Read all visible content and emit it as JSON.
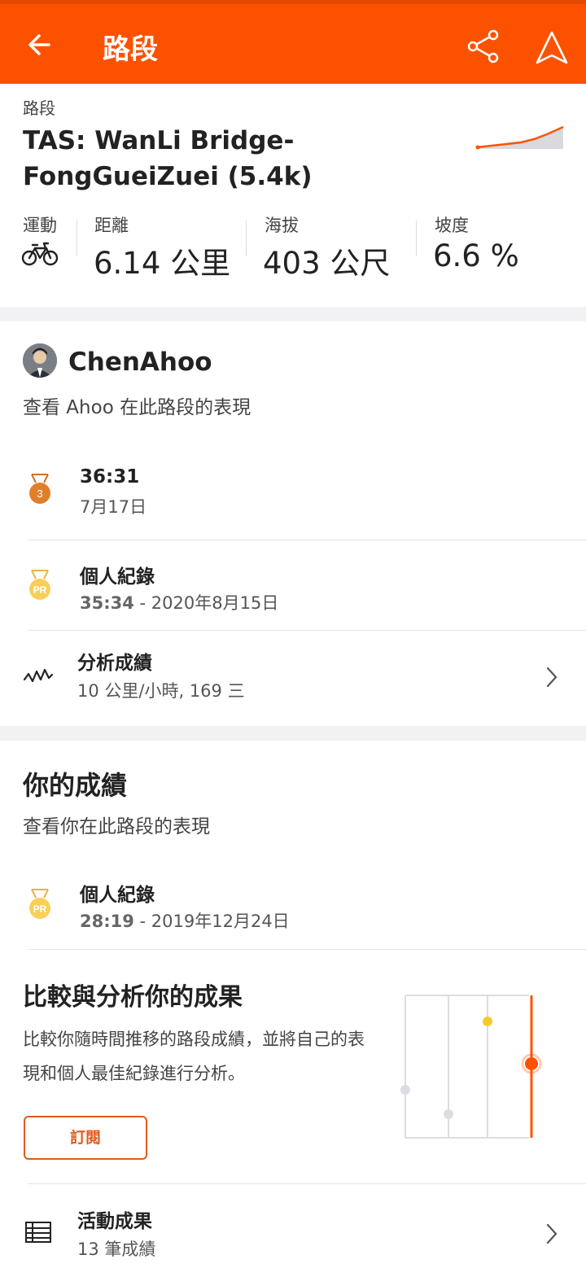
{
  "header": {
    "title": "路段",
    "back_icon": "arrow-left-icon",
    "share_icon": "share-icon",
    "nav_icon": "navigation-arrow-icon",
    "brand_color": "#fc5200"
  },
  "segment": {
    "label": "路段",
    "name": "TAS: WanLi Bridge-FongGueiZuei (5.4k)",
    "stats": {
      "sport_label": "運動",
      "sport_icon": "bike-icon",
      "distance_label": "距離",
      "distance_value": "6.14 公里",
      "elevation_label": "海拔",
      "elevation_value": "403 公尺",
      "grade_label": "坡度",
      "grade_value": "6.6 %"
    }
  },
  "athlete": {
    "name": "ChenAhoo",
    "subtitle": "查看 Ahoo 在此路段的表現",
    "effort": {
      "time": "36:31",
      "date": "7月17日",
      "rank": "3"
    },
    "pr": {
      "title": "個人紀錄",
      "time": "35:34",
      "date": " - 2020年8月15日",
      "badge": "PR"
    },
    "analysis": {
      "title": "分析成績",
      "detail": "10 公里/小時, 169 三"
    }
  },
  "you": {
    "title": "你的成績",
    "subtitle": "查看你在此路段的表現",
    "pr": {
      "title": "個人紀錄",
      "time": "28:19",
      "date": " - 2019年12月24日",
      "badge": "PR"
    },
    "promo": {
      "title": "比較與分析你的成果",
      "text": "比較你隨時間推移的路段成績，並將自己的表現和個人最佳紀錄進行分析。",
      "button": "訂閱"
    },
    "activity": {
      "title": "活動成果",
      "detail": "13 筆成績"
    }
  }
}
